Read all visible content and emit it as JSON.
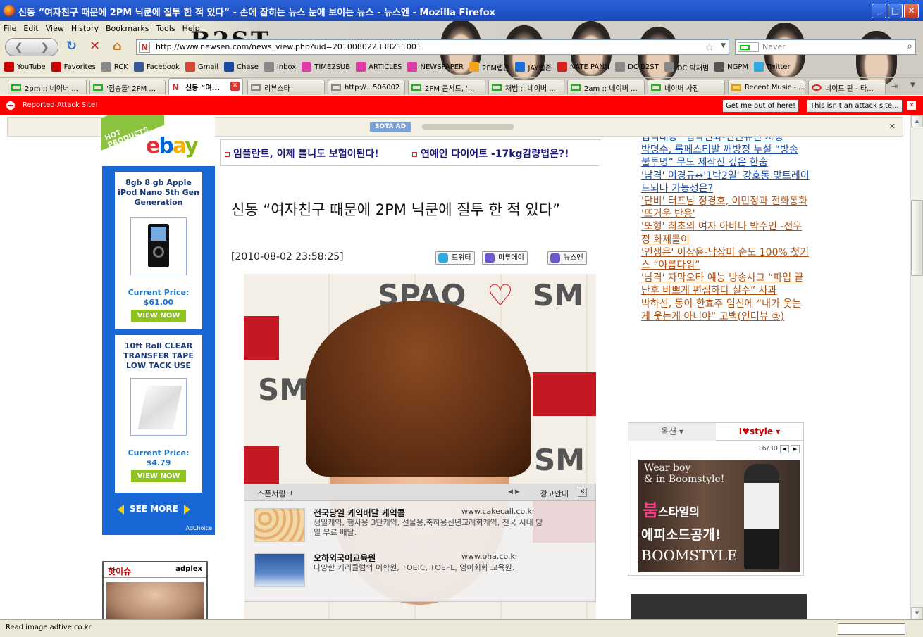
{
  "window": {
    "title": "신동 “여자친구 때문에 2PM 닉쿤에 질투 한 적 있다” - 손에 잡히는 뉴스 눈에 보이는 뉴스 - 뉴스엔 - Mozilla Firefox",
    "controls": [
      "_",
      "□",
      "✕"
    ]
  },
  "menu": [
    "File",
    "Edit",
    "View",
    "History",
    "Bookmarks",
    "Tools",
    "Help"
  ],
  "navigation": {
    "url": "http://www.newsen.com/news_view.php?uid=201008022338211001",
    "search_placeholder": "Naver"
  },
  "persona_banner": "B2ST",
  "bookmarks": [
    {
      "label": "YouTube",
      "color": "#cc0000"
    },
    {
      "label": "Favorites",
      "color": "#cc0000"
    },
    {
      "label": "RCK",
      "color": "#888888"
    },
    {
      "label": "Facebook",
      "color": "#3b5998"
    },
    {
      "label": "Gmail",
      "color": "#d44638"
    },
    {
      "label": "Chase",
      "color": "#1a4ba0"
    },
    {
      "label": "Inbox",
      "color": "#888888"
    },
    {
      "label": "TIME2SUB",
      "color": "#e03ca8"
    },
    {
      "label": "ARTICLES",
      "color": "#e03ca8"
    },
    {
      "label": "NEWSPAPER",
      "color": "#e03ca8"
    },
    {
      "label": "2PM랩존",
      "color": "#f4a31c"
    },
    {
      "label": "JAY랩존",
      "color": "#1a6fd6"
    },
    {
      "label": "NATE PANN",
      "color": "#d62020"
    },
    {
      "label": "DC B2ST",
      "color": "#888888"
    },
    {
      "label": "DC 박재범",
      "color": "#888888"
    },
    {
      "label": "NGPM",
      "color": "#555555"
    },
    {
      "label": "Twitter",
      "color": "#33aadd"
    }
  ],
  "tabs": [
    {
      "label": "2pm :: 네이버 ..."
    },
    {
      "label": "'짐승돌' 2PM ..."
    },
    {
      "label": "신동 “여...",
      "active": true
    },
    {
      "label": "리뷰스타"
    },
    {
      "label": "http://...506002"
    },
    {
      "label": "2PM 콘서트, '..."
    },
    {
      "label": "재범 :: 네이버 ..."
    },
    {
      "label": "2am :: 네이버 ..."
    },
    {
      "label": "네이버 사전"
    },
    {
      "label": "Recent Music - ..."
    },
    {
      "label": "네이트 판 - 타..."
    }
  ],
  "attack_bar": {
    "message": "Reported Attack Site!",
    "get_out": "Get me out of here!",
    "not_attack": "This isn't an attack site..."
  },
  "notice": {
    "badge": "SOTA AD"
  },
  "ebay_ad": {
    "ribbon": "HOT PRODUCTS",
    "logo": [
      "e",
      "b",
      "a",
      "y"
    ],
    "products": [
      {
        "title": "8gb 8 gb Apple iPod Nano 5th Gen Generation",
        "price_label": "Current Price:",
        "price": "$61.00",
        "cta": "VIEW NOW"
      },
      {
        "title": "10ft Roll CLEAR TRANSFER TAPE LOW TACK USE",
        "price_label": "Current Price:",
        "price": "$4.79",
        "cta": "VIEW NOW"
      }
    ],
    "see_more": "SEE MORE",
    "adchoice": "AdChoice"
  },
  "hot_issue": {
    "title": "핫이슈",
    "brand": "adplex"
  },
  "article": {
    "top_links": [
      "임플란트, 이제 틀니도 보험이된다!",
      "연예인 다이어트 -17kg감량법은?!"
    ],
    "headline": "신동 “여자친구 때문에 2PM 닉쿤에 질투 한 적 있다”",
    "date": "[2010-08-02 23:58:25]",
    "share": [
      {
        "label": "트위터",
        "color": "#33aadd"
      },
      {
        "label": "미투데이",
        "color": "#6a5acd"
      },
      {
        "label": "뉴스엔",
        "color": "#6a5acd"
      }
    ],
    "photo_text": [
      "SPAO",
      "♡",
      "SM"
    ]
  },
  "sponsor": {
    "title": "스폰서링크",
    "ad_info": "광고안내",
    "items": [
      {
        "title": "전국당일 케익배달 케익콜",
        "url": "www.cakecall.co.kr",
        "desc": "생일케익, 행사용 3단케익, 선물용,축하용신년교례회케익, 전국 시내 당일 무료 배달."
      },
      {
        "title": "오하외국어교육원",
        "url": "www.oha.co.kr",
        "desc": "다양한 커리큘럼의 어학원, TOEIC, TOEFL, 영어회화 교육원."
      }
    ]
  },
  "right_links": [
    {
      "text": "법적대응 “협박전화-인권유린 자행”",
      "color": "blue"
    },
    {
      "text": "박명수, 록페스티발 깨방정 누설 “방송 불투명” 무도 제작진 깊은 한숨",
      "color": "blue"
    },
    {
      "text": "'남격' 이경규↔'1박2일' 강호동 맞트레이드되나 가능성은?",
      "color": "blue"
    },
    {
      "text": "'단비' 터프남 정경호, 이민정과 전화통화 '뜨거운 반응'",
      "color": "brown"
    },
    {
      "text": "'또형' 최초의 여자 아바타 박수인 -전우정 화제몰이",
      "color": "brown"
    },
    {
      "text": "'인생은' 이상윤-남상미 순도 100% 첫키스 “아름다워”",
      "color": "brown"
    },
    {
      "text": "'남격' 자막오타 예능 방송사고 “파업 끝난후 바쁘게 편집하다 실수” 사과",
      "color": "brown"
    },
    {
      "text": "박하선, 동이 한효주 임신에 “내가 웃는게 웃는게 아니야” 고백(인터뷰 ②)",
      "color": "brown"
    }
  ],
  "style_box": {
    "tab_option": "옥션",
    "tab_style": "I♥style",
    "page": "16/30",
    "img_top": [
      "Wear boy",
      "& in Boomstyle!"
    ],
    "img_k1a": "붐",
    "img_k1b": "스타일의",
    "img_k2": "에피소드공개!",
    "img_brand": "BOOMSTYLE"
  },
  "status": "Read image.adtive.co.kr"
}
